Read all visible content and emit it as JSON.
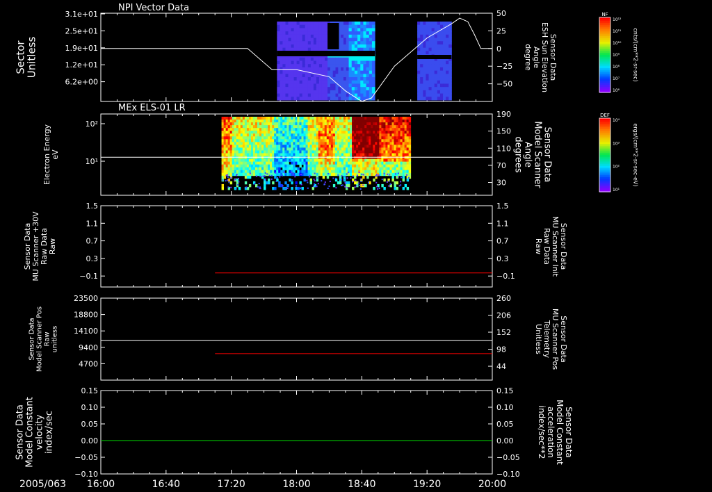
{
  "figure": {
    "date_label": "2005/063",
    "time_ticks": [
      "16:00",
      "16:40",
      "17:20",
      "18:00",
      "18:40",
      "19:20",
      "20:00"
    ],
    "time_range_min": [
      960,
      1200
    ]
  },
  "chart_data": [
    {
      "type": "heatmap",
      "title": "NPI Vector Data",
      "ylabel_left": [
        "Sector",
        "Unitless"
      ],
      "yticks_left": [
        "3.1e+01",
        "2.5e+01",
        "1.9e+01",
        "1.2e+01",
        "6.2e+00"
      ],
      "ylabel_right": [
        "Sensor Data",
        "ESH Sun Elevation",
        "Angle",
        "degree"
      ],
      "yticks_right": [
        "50",
        "25",
        "0",
        "−25",
        "−50"
      ],
      "ylim_right": [
        -75,
        50
      ],
      "colorbar": {
        "label": "NF",
        "unit": "cnts/(cm**2-sr-sec)",
        "ticks": [
          "10¹²",
          "10¹¹",
          "10¹⁰",
          "10⁹",
          "10⁸",
          "10⁷",
          "10⁶"
        ]
      },
      "line_series": {
        "color": "#ffffff",
        "x": [
          960,
          1050,
          1065,
          1080,
          1100,
          1110,
          1120,
          1126,
          1140,
          1160,
          1175,
          1180,
          1185,
          1189,
          1193,
          1200
        ],
        "y": [
          0,
          0,
          -30,
          -30,
          -40,
          -60,
          -75,
          -70,
          -25,
          15,
          35,
          43,
          38,
          20,
          0,
          0
        ]
      },
      "data_blocks": [
        {
          "x": [
            1068,
            1099
          ],
          "color": "#5535ee"
        },
        {
          "x": [
            1099,
            1112
          ],
          "color": "#3a55ee"
        },
        {
          "x": [
            1112,
            1128
          ],
          "color": "#2a7cf0"
        },
        {
          "x": [
            1154,
            1175
          ],
          "color": "#3a4cee"
        }
      ]
    },
    {
      "type": "heatmap",
      "title": "MEx ELS-01 LR",
      "ylabel_left": [
        "Electron Energy",
        "eV"
      ],
      "yticks_left": [
        "10²",
        "10¹"
      ],
      "ylabel_right": [
        "Sensor Data",
        "Model Scanner",
        "Angle",
        "degrees"
      ],
      "yticks_right": [
        "190",
        "150",
        "110",
        "70",
        "30"
      ],
      "ylim_right": [
        0,
        190
      ],
      "colorbar": {
        "label": "DEF",
        "unit": "ergs/(cm**2-sr-sec-eV)",
        "ticks": [
          "10⁴",
          "10³",
          "10²",
          "10¹"
        ]
      },
      "line_series": {
        "color": "#ffffff",
        "x": [
          960,
          1200
        ],
        "y": [
          89,
          89
        ]
      },
      "data_range": [
        1034,
        1150
      ]
    },
    {
      "type": "line",
      "ylabel_left": [
        "Sensor Data",
        "MU Scanner +30V",
        "Raw Data",
        "Raw"
      ],
      "yticks_left": [
        "1.5",
        "1.1",
        "0.7",
        "0.3",
        "−0.1"
      ],
      "ylim_left": [
        -0.35,
        1.5
      ],
      "ylabel_right": [
        "Sensor Data",
        "MU Scanner Init",
        "Raw Data",
        "Raw"
      ],
      "yticks_right": [
        "1.5",
        "1.1",
        "0.7",
        "0.3",
        "−0.1"
      ],
      "ylim_right": [
        -0.35,
        1.5
      ],
      "series": [
        {
          "color": "#ff0000",
          "axis": "right",
          "x": [
            1030,
            1200
          ],
          "y": [
            -0.03,
            -0.03
          ]
        }
      ]
    },
    {
      "type": "line",
      "ylabel_left": [
        "Sensor Data",
        "Model Scanner Pos",
        "Raw",
        "unitless"
      ],
      "yticks_left": [
        "23500",
        "18800",
        "14100",
        "9400",
        "4700"
      ],
      "ylim_left": [
        0,
        23500
      ],
      "ylabel_right": [
        "Sensor Data",
        "MU Scanner Pos",
        "Telemetry",
        "Unitless"
      ],
      "yticks_right": [
        "260",
        "206",
        "152",
        "98",
        "44"
      ],
      "ylim_right": [
        0,
        260
      ],
      "series": [
        {
          "color": "#ffffff",
          "axis": "left",
          "x": [
            960,
            1200
          ],
          "y": [
            11400,
            11400
          ]
        },
        {
          "color": "#ff0000",
          "axis": "right",
          "x": [
            1030,
            1200
          ],
          "y": [
            84,
            84
          ]
        }
      ]
    },
    {
      "type": "line",
      "ylabel_left": [
        "Sensor Data",
        "Model Constant",
        "velocity",
        "index/sec"
      ],
      "yticks_left": [
        "0.15",
        "0.10",
        "0.05",
        "0.00",
        "−0.05",
        "−0.10"
      ],
      "ylim_left": [
        -0.1,
        0.15
      ],
      "ylabel_right": [
        "Sensor Data",
        "Model Constant",
        "acceleration",
        "index/sec**2"
      ],
      "yticks_right": [
        "0.15",
        "0.10",
        "0.05",
        "0.00",
        "−0.05",
        "−0.10"
      ],
      "ylim_right": [
        -0.1,
        0.15
      ],
      "series": [
        {
          "color": "#00dd00",
          "axis": "left",
          "x": [
            960,
            1200
          ],
          "y": [
            0,
            0
          ]
        }
      ]
    }
  ]
}
